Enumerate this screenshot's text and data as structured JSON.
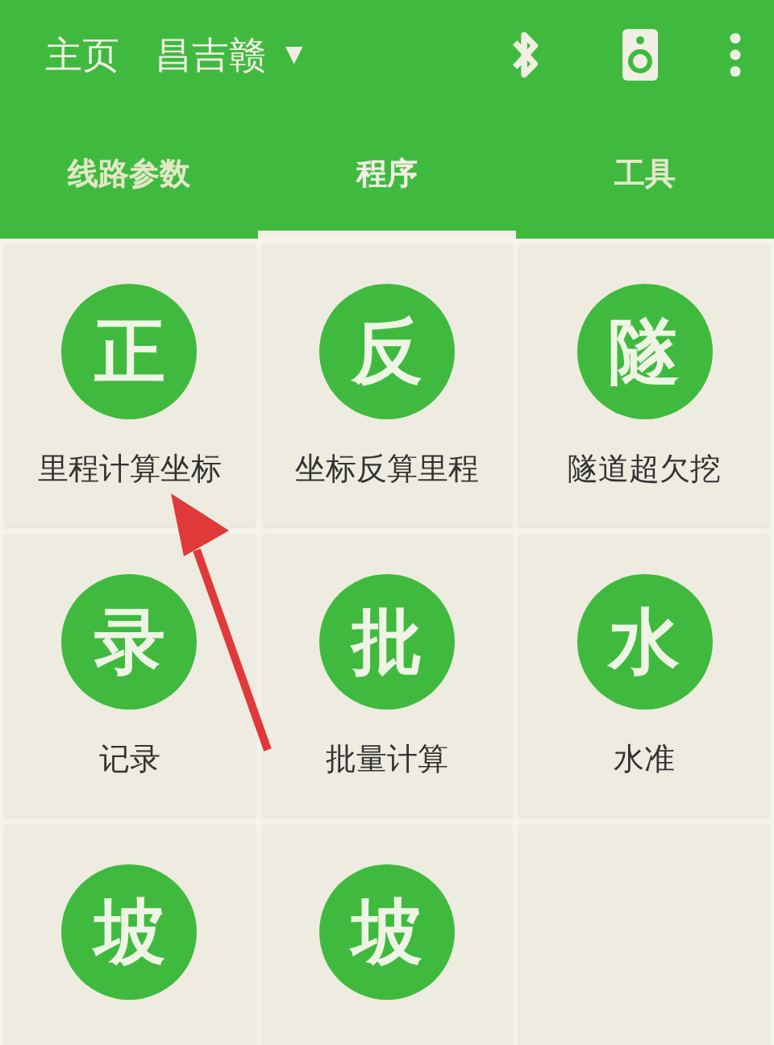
{
  "top_bar": {
    "home": "主页",
    "project": "昌吉赣",
    "dropdown_icon": "▼"
  },
  "tabs": [
    {
      "label": "线路参数",
      "selected": false
    },
    {
      "label": "程序",
      "selected": true
    },
    {
      "label": "工具",
      "selected": false
    }
  ],
  "programs": [
    {
      "glyph": "正",
      "label": "里程计算坐标"
    },
    {
      "glyph": "反",
      "label": "坐标反算里程"
    },
    {
      "glyph": "隧",
      "label": "隧道超欠挖"
    },
    {
      "glyph": "录",
      "label": "记录"
    },
    {
      "glyph": "批",
      "label": "批量计算"
    },
    {
      "glyph": "水",
      "label": "水准"
    },
    {
      "glyph": "坡"
    },
    {
      "glyph": "坡"
    }
  ],
  "annotation": {
    "kind": "arrow"
  }
}
